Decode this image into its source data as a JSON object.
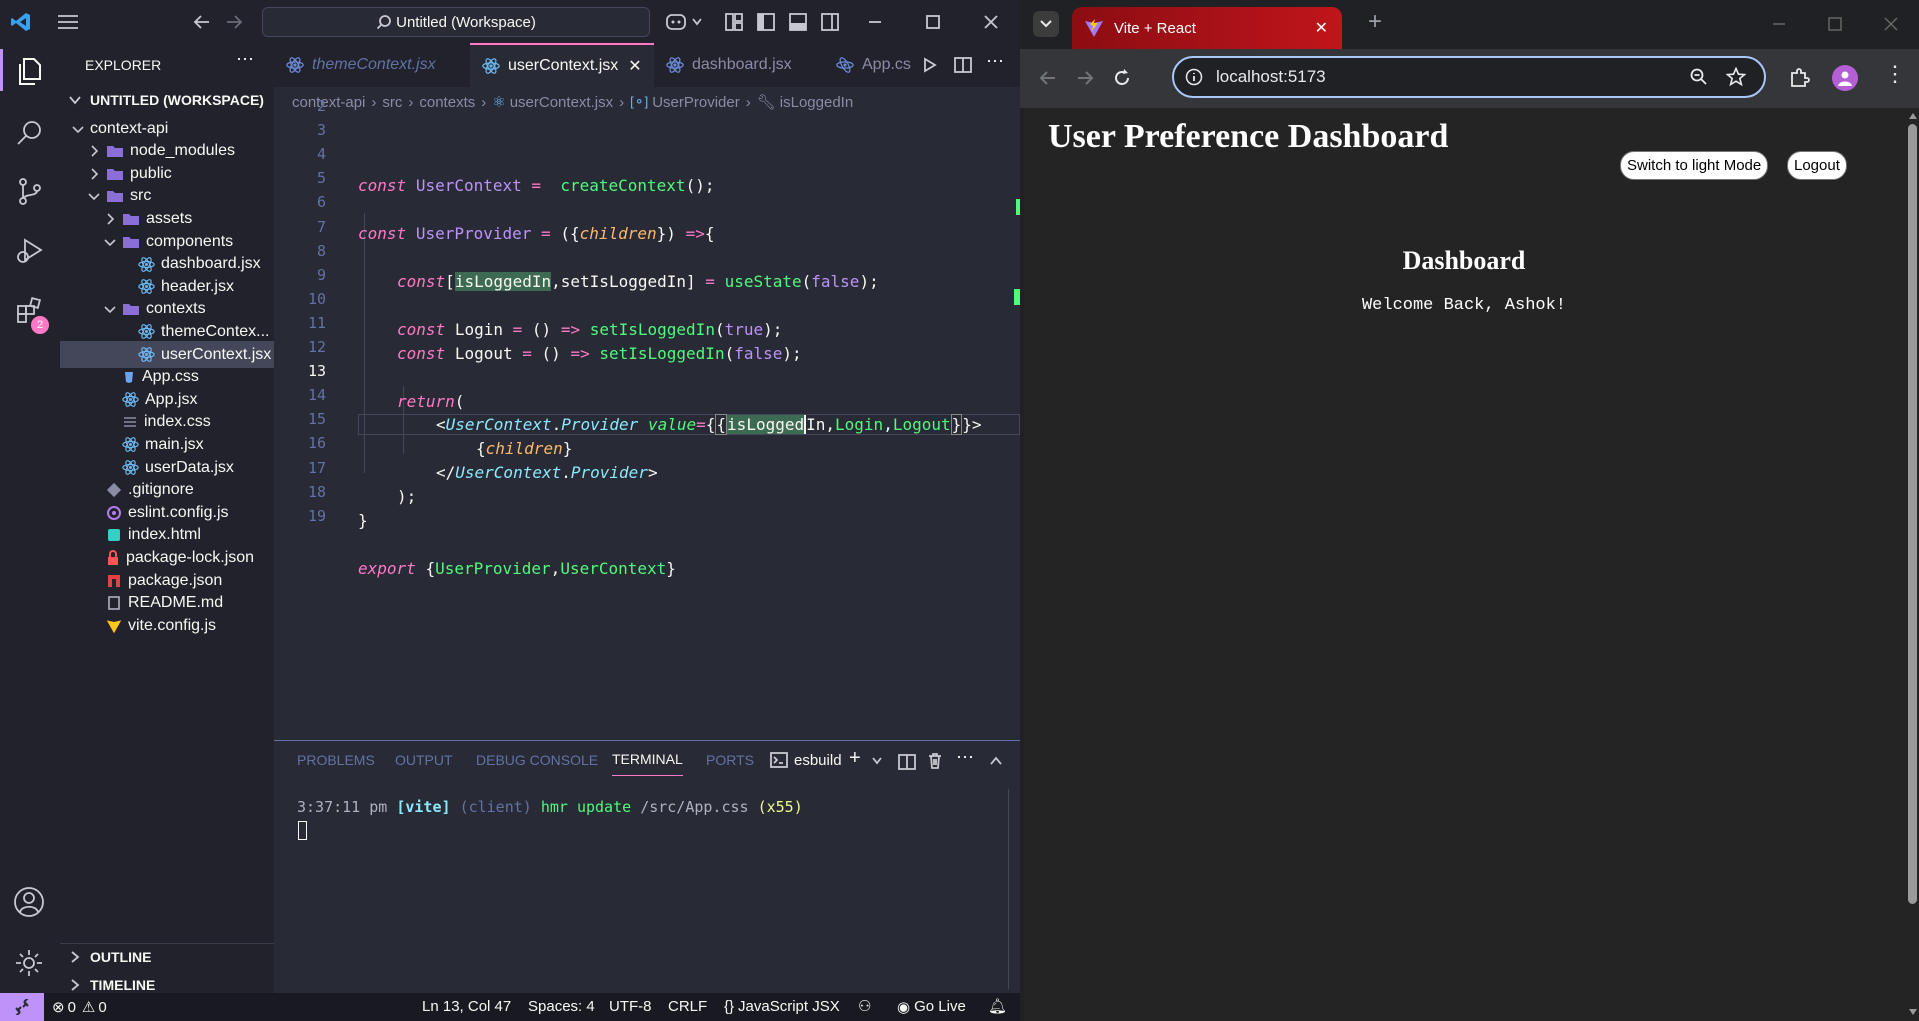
{
  "vscode": {
    "title": "Untitled (Workspace)",
    "explorer_label": "EXPLORER",
    "workspace_label": "UNTITLED (WORKSPACE)",
    "extensions_badge": "2",
    "tabs": [
      {
        "label": "themeContext.jsx",
        "active": false,
        "italic": true
      },
      {
        "label": "userContext.jsx",
        "active": true,
        "italic": false
      },
      {
        "label": "dashboard.jsx",
        "active": false,
        "italic": false
      },
      {
        "label": "App.cs",
        "active": false,
        "italic": false
      }
    ],
    "breadcrumb": [
      "context-api",
      "src",
      "contexts",
      "userContext.jsx",
      "UserProvider",
      "isLoggedIn"
    ],
    "tree": [
      {
        "label": "context-api",
        "depth": 0,
        "type": "folder-open"
      },
      {
        "label": "node_modules",
        "depth": 1,
        "type": "folder"
      },
      {
        "label": "public",
        "depth": 1,
        "type": "folder"
      },
      {
        "label": "src",
        "depth": 1,
        "type": "folder-open"
      },
      {
        "label": "assets",
        "depth": 2,
        "type": "folder"
      },
      {
        "label": "components",
        "depth": 2,
        "type": "folder-open"
      },
      {
        "label": "dashboard.jsx",
        "depth": 3,
        "type": "react"
      },
      {
        "label": "header.jsx",
        "depth": 3,
        "type": "react"
      },
      {
        "label": "contexts",
        "depth": 2,
        "type": "folder-open"
      },
      {
        "label": "themeContex...",
        "depth": 3,
        "type": "react"
      },
      {
        "label": "userContext.jsx",
        "depth": 3,
        "type": "react",
        "selected": true
      },
      {
        "label": "App.css",
        "depth": 2,
        "type": "css"
      },
      {
        "label": "App.jsx",
        "depth": 2,
        "type": "react"
      },
      {
        "label": "index.css",
        "depth": 2,
        "type": "lines"
      },
      {
        "label": "main.jsx",
        "depth": 2,
        "type": "react"
      },
      {
        "label": "userData.jsx",
        "depth": 2,
        "type": "react"
      },
      {
        "label": ".gitignore",
        "depth": 1,
        "type": "git"
      },
      {
        "label": "eslint.config.js",
        "depth": 1,
        "type": "eslint"
      },
      {
        "label": "index.html",
        "depth": 1,
        "type": "html"
      },
      {
        "label": "package-lock.json",
        "depth": 1,
        "type": "lock"
      },
      {
        "label": "package.json",
        "depth": 1,
        "type": "npm"
      },
      {
        "label": "README.md",
        "depth": 1,
        "type": "readme"
      },
      {
        "label": "vite.config.js",
        "depth": 1,
        "type": "vite"
      }
    ],
    "outline_label": "OUTLINE",
    "timeline_label": "TIMELINE",
    "line_numbers": [
      "2",
      "3",
      "4",
      "5",
      "6",
      "7",
      "8",
      "9",
      "10",
      "11",
      "12",
      "13",
      "14",
      "15",
      "16",
      "17",
      "18",
      "19"
    ],
    "panel_tabs": [
      "PROBLEMS",
      "OUTPUT",
      "DEBUG CONSOLE",
      "TERMINAL",
      "PORTS"
    ],
    "active_panel_tab": "TERMINAL",
    "terminal_name": "esbuild",
    "terminal_line": {
      "time": "3:37:11 pm",
      "tag": "[vite]",
      "scope": "(client)",
      "msg": "hmr update",
      "path": "/src/App.css",
      "count": "(x55)"
    },
    "status": {
      "errors": "0",
      "warnings": "0",
      "position": "Ln 13, Col 47",
      "spaces": "Spaces: 4",
      "encoding": "UTF-8",
      "eol": "CRLF",
      "language": "JavaScript JSX",
      "golive": "Go Live"
    }
  },
  "browser": {
    "tab_title": "Vite + React",
    "url": "localhost:5173",
    "page": {
      "heading": "User Preference Dashboard",
      "theme_button": "Switch to light Mode",
      "logout_button": "Logout",
      "section_title": "Dashboard",
      "welcome": "Welcome Back, Ashok!"
    }
  },
  "colors": {
    "accent": "#bd93f9",
    "keyword": "#ff79c6",
    "function": "#50fa7b",
    "string_param": "#ffb86c",
    "class": "#8be9fd",
    "status_left": "#bd93f9"
  }
}
